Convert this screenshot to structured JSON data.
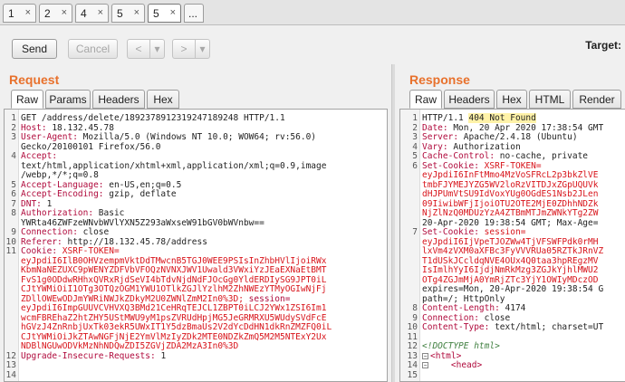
{
  "tabs": [
    {
      "label": "1",
      "close": "×"
    },
    {
      "label": "2",
      "close": "×"
    },
    {
      "label": "4",
      "close": "×"
    },
    {
      "label": "5",
      "close": "×"
    },
    {
      "label": "5",
      "close": "×"
    },
    {
      "label": "...",
      "close": ""
    }
  ],
  "toolbar": {
    "send": "Send",
    "cancel": "Cancel",
    "back": "<",
    "back_menu": "▾",
    "fwd": ">",
    "fwd_menu": "▾",
    "target": "Target:"
  },
  "request": {
    "title": "Request",
    "tabs": [
      "Raw",
      "Params",
      "Headers",
      "Hex"
    ],
    "active_tab": "Raw",
    "lines": [
      {
        "n": "1",
        "k": "",
        "v": "GET /address/delete/1892378912319247189248 HTTP/1.1"
      },
      {
        "n": "2",
        "k": "Host:",
        "v": " 18.132.45.78"
      },
      {
        "n": "3",
        "k": "User-Agent:",
        "v": " Mozilla/5.0 (Windows NT 10.0; WOW64; rv:56.0)"
      },
      {
        "n": "",
        "k": "",
        "v": "Gecko/20100101 Firefox/56.0"
      },
      {
        "n": "4",
        "k": "Accept:",
        "v": ""
      },
      {
        "n": "",
        "k": "",
        "v": "text/html,application/xhtml+xml,application/xml;q=0.9,image"
      },
      {
        "n": "",
        "k": "",
        "v": "/webp,*/*;q=0.8"
      },
      {
        "n": "5",
        "k": "Accept-Language:",
        "v": " en-US,en;q=0.5"
      },
      {
        "n": "6",
        "k": "Accept-Encoding:",
        "v": " gzip, deflate"
      },
      {
        "n": "7",
        "k": "DNT:",
        "v": " 1"
      },
      {
        "n": "8",
        "k": "Authorization:",
        "v": " Basic"
      },
      {
        "n": "",
        "k": "",
        "v": "YWRta46ZWFzeWNvbWVlYXN5Z293aWxseW91bGV0bWVnbw=="
      },
      {
        "n": "9",
        "k": "Connection:",
        "v": " close"
      },
      {
        "n": "10",
        "k": "Referer:",
        "v": " http://18.132.45.78/address"
      },
      {
        "n": "11",
        "k": "Cookie:",
        "v": " ",
        "r": "XSRF-TOKEN="
      },
      {
        "n": "",
        "k": "",
        "v": "",
        "r": "eyJpdiI6IlB0OHVzempmVktDdTMwcnB5TGJ0WEE9PSIsInZhbHVlIjoiRWx"
      },
      {
        "n": "",
        "k": "",
        "v": "",
        "r": "KbmNaNEZUXC9pWENYZDFVbVFOQzNVNXJWV1Uwald3VWxiYzJEaEXNaEtBMT"
      },
      {
        "n": "",
        "k": "",
        "v": "",
        "r": "FvS1g0ODdwRHhxQVRxRjdSeVI4bTdvNjdNdFJOcGg0YldERDIySG9JPT0iL"
      },
      {
        "n": "",
        "k": "",
        "v": "",
        "r": "CJtYWMiOiI1OTg3OTQzOGM1YWU1OTlkZGJlYzlhM2ZhNWEzYTMyOGIwNjFj"
      },
      {
        "n": "",
        "k": "",
        "v": "",
        "r": "ZDllOWEwODJmYWRiNWJkZDkyM2U0ZWNlZmM2In0%3D;",
        "s": " session="
      },
      {
        "n": "",
        "k": "",
        "v": "",
        "r": "eyJpdiI6ImpGUUVCVHVXQ3BMd21CeHRqTEJCL1ZBPT0iLCJ2YWx1ZSI6Im1"
      },
      {
        "n": "",
        "k": "",
        "v": "",
        "r": "wcmFBREhaZ2htZHY5UStMWU9yM1psZVRUdHpjMG5JeGRMRXU5WUdySVdFcE"
      },
      {
        "n": "",
        "k": "",
        "v": "",
        "r": "hGVzJ4ZnRnbjUxTk03ekR5UWxIT1Y5dzBmaUs2V2dYcDdHN1dkRnZMZFQ0iL"
      },
      {
        "n": "",
        "k": "",
        "v": "",
        "r": "CJtYWMiOiJkZTAwNGFjNjE2YmVlMzIyZDk2MTE0NDZkZmQ5M2M5NTExY2Ux"
      },
      {
        "n": "",
        "k": "",
        "v": "",
        "r": "NDBlNGUwODVkMzNhNDQwZDI5ZGVjZDA2MzA3In0%3D"
      },
      {
        "n": "12",
        "k": "Upgrade-Insecure-Requests:",
        "v": " 1"
      },
      {
        "n": "13",
        "k": "",
        "v": ""
      },
      {
        "n": "14",
        "k": "",
        "v": ""
      }
    ]
  },
  "response": {
    "title": "Response",
    "tabs": [
      "Raw",
      "Headers",
      "Hex",
      "HTML",
      "Render"
    ],
    "active_tab": "Raw",
    "lines": [
      {
        "n": "1",
        "k": "",
        "v": "HTTP/1.1 ",
        "hl": "404 Not Found"
      },
      {
        "n": "2",
        "k": "Date:",
        "v": " Mon, 20 Apr 2020 17:38:54 GMT"
      },
      {
        "n": "3",
        "k": "Server:",
        "v": " Apache/2.4.18 (Ubuntu)"
      },
      {
        "n": "4",
        "k": "Vary:",
        "v": " Authorization"
      },
      {
        "n": "5",
        "k": "Cache-Control:",
        "v": " no-cache, private"
      },
      {
        "n": "6",
        "k": "Set-Cookie:",
        "v": " ",
        "r": "XSRF-TOKEN="
      },
      {
        "n": "",
        "k": "",
        "v": "",
        "r": "eyJpdiI6InFtMmo4MzVoSFRcL2p3bkZlVE"
      },
      {
        "n": "",
        "k": "",
        "v": "",
        "r": "tmbFJYMEJYZG5WV2loRzVITDJxZGpUQUVk"
      },
      {
        "n": "",
        "k": "",
        "v": "",
        "r": "dHJPUmVtSU9IdVoxYUg0OGdES1Nsb2JLen"
      },
      {
        "n": "",
        "k": "",
        "v": "",
        "r": "09IiwibWFjIjoiOTU2OTE2MjE0ZDhhNDZk"
      },
      {
        "n": "",
        "k": "",
        "v": "",
        "r": "NjZlNzQ0MDUzYzA4ZTBmMTJmZWNkYTg2ZW"
      },
      {
        "n": "",
        "k": "",
        "v": "20-Apr-2020 19:38:54 GMT; Max-Age="
      },
      {
        "n": "7",
        "k": "Set-Cookie:",
        "v": " ",
        "r": "session="
      },
      {
        "n": "",
        "k": "",
        "v": "",
        "r": "eyJpdiI6IjVpeTJOZWw4TjVFSWFPdk0rMH"
      },
      {
        "n": "",
        "k": "",
        "v": "",
        "r": "lxVm4zVXM0aXFBc3FyVVVRUa05RZTkJRnVZ"
      },
      {
        "n": "",
        "k": "",
        "v": "",
        "r": "T1dUSkJCcldqNVE4OUx4Q0taa3hpREgzMV"
      },
      {
        "n": "",
        "k": "",
        "v": "",
        "r": "IsImlhYyI6IjdjNmRkMzg3ZGJkYjhlMWU2"
      },
      {
        "n": "",
        "k": "",
        "v": "",
        "r": "OTg4ZGJmMjA0YmRjZTc3YjY1OWIyMDczOD"
      },
      {
        "n": "",
        "k": "",
        "v": "expires=Mon, 20-Apr-2020 19:38:54 G"
      },
      {
        "n": "",
        "k": "",
        "v": "path=/; HttpOnly"
      },
      {
        "n": "8",
        "k": "Content-Length:",
        "v": " 4174"
      },
      {
        "n": "9",
        "k": "Connection:",
        "v": " close"
      },
      {
        "n": "10",
        "k": "Content-Type:",
        "v": " text/html; charset=UT"
      },
      {
        "n": "11",
        "k": "",
        "v": ""
      },
      {
        "n": "12",
        "k": "",
        "v": "",
        "cm": "<!DOCTYPE html>"
      },
      {
        "n": "13",
        "k": "",
        "v": "",
        "tg": "<html>",
        "fold": "−"
      },
      {
        "n": "14",
        "k": "",
        "v": "",
        "tg": "    <head>",
        "fold": "−"
      },
      {
        "n": "15",
        "k": "",
        "v": "",
        "tg": ""
      }
    ]
  }
}
